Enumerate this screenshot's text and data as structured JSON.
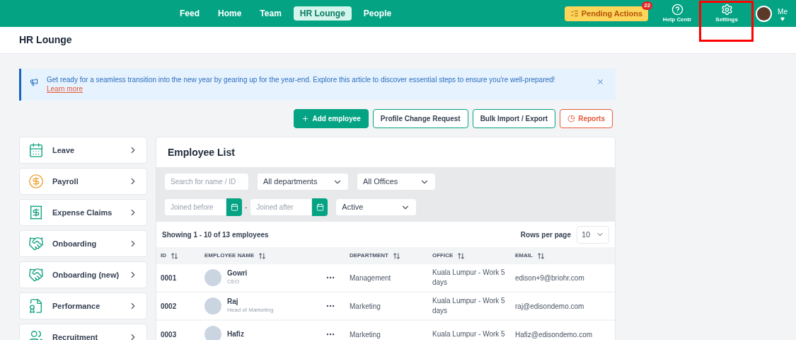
{
  "nav": {
    "tabs": [
      {
        "label": "Feed",
        "selected": false
      },
      {
        "label": "Home",
        "selected": false
      },
      {
        "label": "Team",
        "selected": false
      },
      {
        "label": "HR Lounge",
        "selected": true
      },
      {
        "label": "People",
        "selected": false
      }
    ],
    "pending": {
      "label": "Pending Actions",
      "count": "22"
    },
    "tools": [
      {
        "kind": "help",
        "label": "Help Centr",
        "highlighted": false
      },
      {
        "kind": "settings",
        "label": "Settings",
        "highlighted": true
      }
    ],
    "profile": {
      "label": "Me"
    }
  },
  "page_title": "HR Lounge",
  "banner": {
    "text": "Get ready for a seamless transition into the new year by gearing up for the year-end. Explore this article to discover essential steps to ensure you're well-prepared!",
    "link": "Learn more"
  },
  "actions": [
    {
      "kind": "primary",
      "label": "Add employee"
    },
    {
      "kind": "outline",
      "label": "Profile Change Request"
    },
    {
      "kind": "outline",
      "label": "Bulk Import / Export"
    },
    {
      "kind": "reports",
      "label": "Reports"
    }
  ],
  "sidebar": {
    "items": [
      {
        "kind": "calendar",
        "label": "Leave"
      },
      {
        "kind": "money",
        "label": "Payroll"
      },
      {
        "kind": "receipt",
        "label": "Expense Claims"
      },
      {
        "kind": "handshake",
        "label": "Onboarding"
      },
      {
        "kind": "handshake",
        "label": "Onboarding (new)"
      },
      {
        "kind": "badge",
        "label": "Performance"
      },
      {
        "kind": "people",
        "label": "Recruitment"
      }
    ]
  },
  "employee_list": {
    "title": "Employee List",
    "filters": {
      "search": {
        "placeholder": "Search for name / ID"
      },
      "department": "All departments",
      "office": "All Offices",
      "joined_before": {
        "placeholder": "Joined before"
      },
      "separator": "-",
      "joined_after": {
        "placeholder": "Joined after"
      },
      "status": "Active"
    },
    "showing": "Showing 1 - 10 of 13 employees",
    "rows_per_page": {
      "label": "Rows per page",
      "value": "10"
    },
    "columns": [
      "ID",
      "EMPLOYEE NAME",
      "DEPARTMENT",
      "OFFICE",
      "EMAIL"
    ],
    "rows": [
      {
        "id": "0001",
        "name": "Gowri",
        "role": "CEO",
        "department": "Management",
        "office": "Kuala Lumpur - Work 5 days",
        "email": "edison+9@briohr.com"
      },
      {
        "id": "0002",
        "name": "Raj",
        "role": "Head of Marketing",
        "department": "Marketing",
        "office": "Kuala Lumpur - Work 5 days",
        "email": "raj@edisondemo.com"
      },
      {
        "id": "0003",
        "name": "Hafiz",
        "department": "Marketing",
        "office": "Kuala Lumpur - Work 5",
        "email": "Hafiz@edisondemo.com"
      }
    ]
  }
}
